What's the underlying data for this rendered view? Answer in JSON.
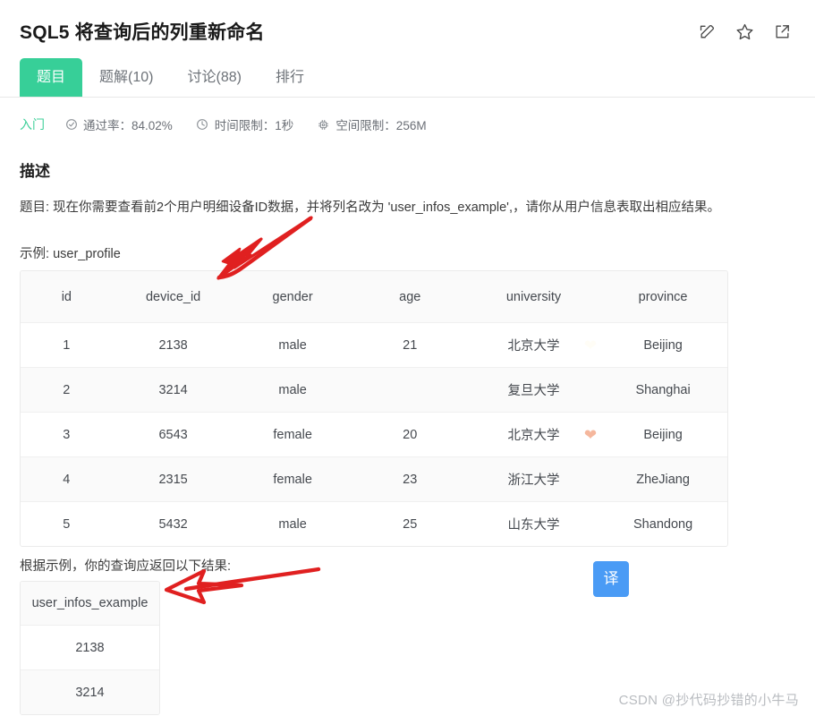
{
  "header": {
    "problem_code": "SQL5",
    "title": "SQL5  将查询后的列重新命名",
    "actions": [
      {
        "name": "edit-icon",
        "label": "编辑"
      },
      {
        "name": "star-icon",
        "label": "收藏"
      },
      {
        "name": "share-icon",
        "label": "分享"
      }
    ]
  },
  "tabs": [
    {
      "label": "题目",
      "active": true
    },
    {
      "label": "题解(10)",
      "active": false
    },
    {
      "label": "讨论(88)",
      "active": false
    },
    {
      "label": "排行",
      "active": false
    }
  ],
  "meta": {
    "level": "入门",
    "items": [
      {
        "icon": "check-circle-icon",
        "label": "通过率：84.02%"
      },
      {
        "icon": "clock-icon",
        "label": "时间限制：1秒"
      },
      {
        "icon": "memory-chip-icon",
        "label": "空间限制：256M"
      }
    ]
  },
  "description": {
    "heading": "描述",
    "body": "题目: 现在你需要查看前2个用户明细设备ID数据，并将列名改为 'user_infos_example',，请你从用户信息表取出相应结果。",
    "example_label": "示例:",
    "example_table_name": "user_profile"
  },
  "example_table": {
    "columns": [
      "id",
      "device_id",
      "gender",
      "age",
      "university",
      "province"
    ],
    "rows": [
      {
        "id": "1",
        "device_id": "2138",
        "gender": "male",
        "age": "21",
        "university": "北京大学",
        "province": "Beijing"
      },
      {
        "id": "2",
        "device_id": "3214",
        "gender": "male",
        "age": "",
        "university": "复旦大学",
        "province": "Shanghai"
      },
      {
        "id": "3",
        "device_id": "6543",
        "gender": "female",
        "age": "20",
        "university": "北京大学",
        "province": "Beijing"
      },
      {
        "id": "4",
        "device_id": "2315",
        "gender": "female",
        "age": "23",
        "university": "浙江大学",
        "province": "ZheJiang"
      },
      {
        "id": "5",
        "device_id": "5432",
        "gender": "male",
        "age": "25",
        "university": "山东大学",
        "province": "Shandong"
      }
    ]
  },
  "result": {
    "intro": "根据示例，你的查询应返回以下结果:",
    "columns": [
      "user_infos_example"
    ],
    "rows": [
      [
        "2138"
      ],
      [
        "3214"
      ]
    ]
  },
  "translate_button": {
    "label": "译"
  },
  "watermark": {
    "text": "CSDN @抄代码抄错的小牛马"
  },
  "colors": {
    "accent_green": "#37cf98",
    "level_green": "#3fd09a",
    "translate_blue": "#4a9bf5",
    "heart_salmon": "#f5b79d",
    "annotation_red": "#e02020",
    "table_header_bg": "#fafafa"
  }
}
